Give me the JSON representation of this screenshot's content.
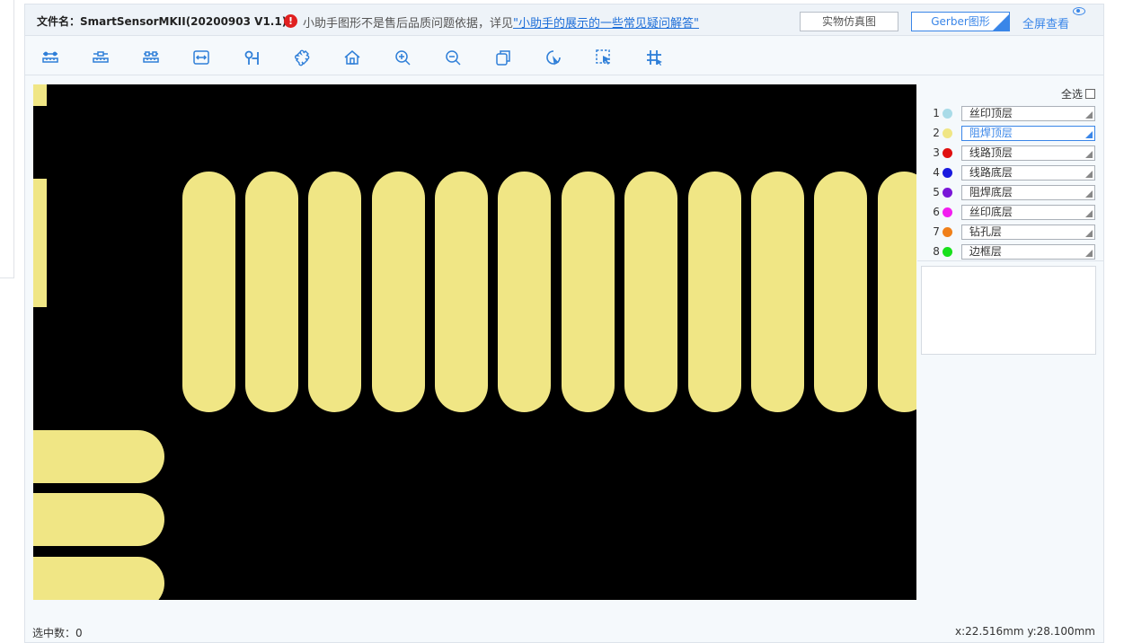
{
  "header": {
    "file_label": "文件名：SmartSensorMKII(20200903 V1.1)",
    "notice_text": "小助手图形不是售后品质问题依据，详见",
    "notice_link": "\"小助手的展示的一些常见疑问解答\"",
    "sim_button": "实物仿真图",
    "gerber_button": "Gerber图形",
    "fullscreen_link": "全屏查看"
  },
  "toolbar": {
    "tools": [
      "measure-icon",
      "measure-2-icon",
      "measure-3-icon",
      "width-measure-icon",
      "probe-icon",
      "puzzle-icon",
      "home-icon",
      "zoom-in-icon",
      "zoom-out-icon",
      "copy-layer-icon",
      "rotate-icon",
      "select-box-icon",
      "grid-icon"
    ]
  },
  "panel": {
    "select_all": "全选",
    "layers": [
      {
        "num": "1",
        "name": "丝印顶层",
        "color": "#a9dbe8",
        "active": false
      },
      {
        "num": "2",
        "name": "阻焊顶层",
        "color": "#f0e685",
        "active": true
      },
      {
        "num": "3",
        "name": "线路顶层",
        "color": "#e01010",
        "active": false
      },
      {
        "num": "4",
        "name": "线路底层",
        "color": "#1a1adf",
        "active": false
      },
      {
        "num": "5",
        "name": "阻焊底层",
        "color": "#7a17d8",
        "active": false
      },
      {
        "num": "6",
        "name": "丝印底层",
        "color": "#f21ef0",
        "active": false
      },
      {
        "num": "7",
        "name": "钻孔层",
        "color": "#f0801a",
        "active": false
      },
      {
        "num": "8",
        "name": "边框层",
        "color": "#18e01c",
        "active": false
      }
    ]
  },
  "footer": {
    "selected_count": "选中数：0",
    "coords": "x:22.516mm y:28.100mm"
  },
  "colors": {
    "pad": "#f0e685",
    "canvas": "#000000",
    "accent": "#3a86e8"
  }
}
